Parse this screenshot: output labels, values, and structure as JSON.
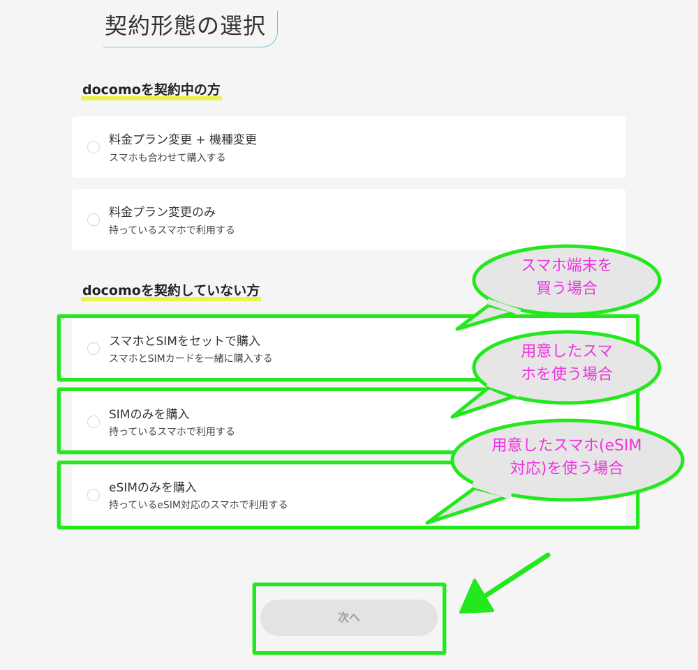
{
  "header": {
    "title": "契約形態の選択"
  },
  "sections": [
    {
      "heading": "docomoを契約中の方",
      "options": [
        {
          "title": "料金プラン変更 + 機種変更",
          "subtitle": "スマホも合わせて購入する"
        },
        {
          "title": "料金プラン変更のみ",
          "subtitle": "持っているスマホで利用する"
        }
      ]
    },
    {
      "heading": "docomoを契約していない方",
      "options": [
        {
          "title": "スマホとSIMをセットで購入",
          "subtitle": "スマホとSIMカードを一緒に購入する"
        },
        {
          "title": "SIMのみを購入",
          "subtitle": "持っているスマホで利用する"
        },
        {
          "title": "eSIMのみを購入",
          "subtitle": "持っているeSIM対応のスマホで利用する"
        }
      ]
    }
  ],
  "footer": {
    "next_label": "次へ"
  },
  "annotations": {
    "bubble_1": {
      "line1": "スマホ端末を",
      "line2": "買う場合"
    },
    "bubble_2": {
      "line1": "用意したスマ",
      "line2": "ホを使う場合"
    },
    "bubble_3": {
      "line1": "用意したスマホ(eSIM",
      "line2": "対応)を使う場合"
    }
  },
  "colors": {
    "background": "#f5f5f5",
    "card": "#ffffff",
    "heading_highlight": "#ecf34a",
    "title_accent": "#6ec3d6",
    "annotation_green": "#22e81d",
    "annotation_text": "#ee33e0",
    "bubble_fill": "#e6e6e6",
    "button_bg": "#e3e3e3",
    "button_text": "#9e9e9e"
  }
}
